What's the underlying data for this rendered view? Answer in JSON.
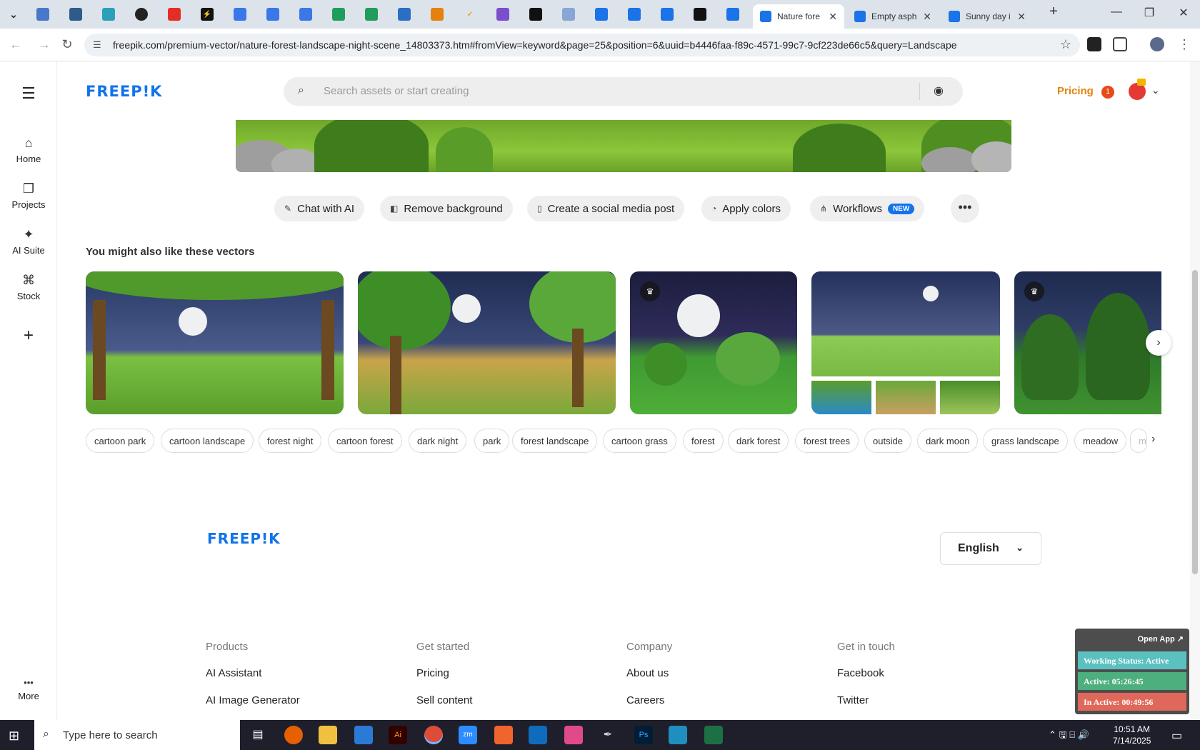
{
  "browser": {
    "tabs": [
      {
        "title": "Nature fore",
        "active": true
      },
      {
        "title": "Empty asph",
        "active": false
      },
      {
        "title": "Sunny day i",
        "active": false
      }
    ],
    "url": "freepik.com/premium-vector/nature-forest-landscape-night-scene_14803373.htm#fromView=keyword&page=25&position=6&uuid=b4446faa-f89c-4571-99c7-9cf223de66c5&query=Landscape",
    "new_tab": "+",
    "close_glyph": "✕",
    "minimize": "—",
    "restore": "❐",
    "close_window": "✕"
  },
  "sidebar": {
    "items": [
      {
        "label": "Home",
        "icon": "home-icon",
        "glyph": "⌂"
      },
      {
        "label": "Projects",
        "icon": "projects-icon",
        "glyph": "❐"
      },
      {
        "label": "AI Suite",
        "icon": "ai-suite-icon",
        "glyph": "✦"
      },
      {
        "label": "Stock",
        "icon": "stock-icon",
        "glyph": "⌘"
      }
    ],
    "add_glyph": "+",
    "more": {
      "label": "More",
      "glyph": "•••"
    }
  },
  "header": {
    "logo": "FREEP!K",
    "search_placeholder": "Search assets or start creating",
    "pricing": "Pricing",
    "notification_count": "1"
  },
  "actions": [
    {
      "label": "Chat with AI",
      "icon": "chat-icon"
    },
    {
      "label": "Remove background",
      "icon": "remove-bg-icon"
    },
    {
      "label": "Create a social media post",
      "icon": "phone-icon"
    },
    {
      "label": "Apply colors",
      "icon": "palette-icon"
    },
    {
      "label": "Workflows",
      "icon": "workflow-icon",
      "badge": "NEW"
    }
  ],
  "related": {
    "title": "You might also like these vectors"
  },
  "tags": [
    "cartoon park",
    "cartoon landscape",
    "forest night",
    "cartoon forest",
    "dark night",
    "park",
    "forest landscape",
    "cartoon grass",
    "forest",
    "dark forest",
    "forest trees",
    "outside",
    "dark moon",
    "grass landscape",
    "meadow",
    "m"
  ],
  "footer": {
    "logo": "FREEP!K",
    "language": "English",
    "columns": [
      {
        "heading": "Products",
        "links": [
          "AI Assistant",
          "AI Image Generator"
        ]
      },
      {
        "heading": "Get started",
        "links": [
          "Pricing",
          "Sell content"
        ]
      },
      {
        "heading": "Company",
        "links": [
          "About us",
          "Careers"
        ]
      },
      {
        "heading": "Get in touch",
        "links": [
          "Facebook",
          "Twitter"
        ]
      }
    ]
  },
  "widget": {
    "open_app": "Open App ↗",
    "status": "Working Status: Active",
    "active": "Active: 05:26:45",
    "inactive": "In Active: 00:49:56",
    "colors": {
      "status": "#5bc0c0",
      "active": "#4caf7d",
      "inactive": "#e0685a"
    }
  },
  "taskbar": {
    "search_placeholder": "Type here to search",
    "time": "10:51 AM",
    "date": "7/14/2025"
  },
  "colors": {
    "brand": "#1273eb",
    "pricing": "#e5820f"
  }
}
